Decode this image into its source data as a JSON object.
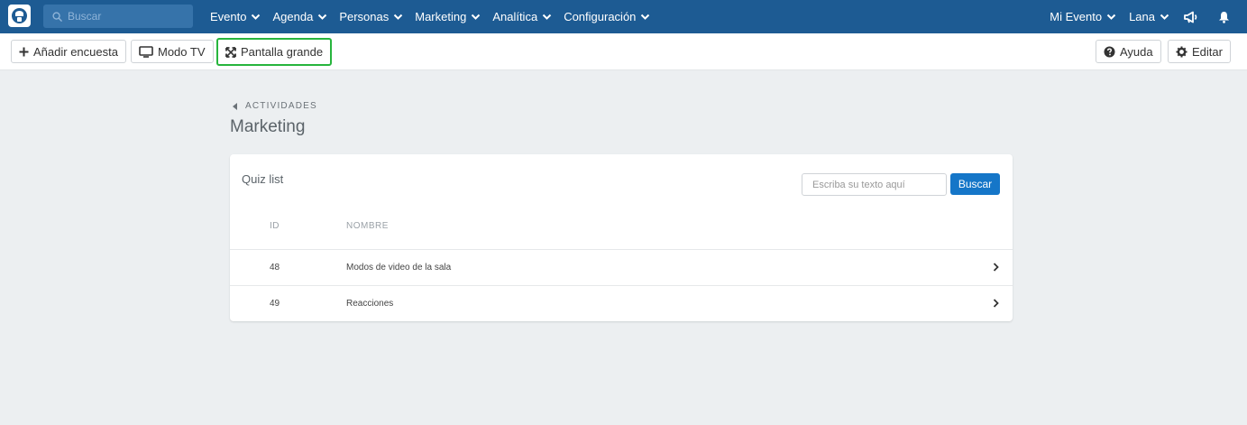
{
  "topbar": {
    "search_placeholder": "Buscar",
    "nav": [
      {
        "label": "Evento"
      },
      {
        "label": "Agenda"
      },
      {
        "label": "Personas"
      },
      {
        "label": "Marketing"
      },
      {
        "label": "Analítica"
      },
      {
        "label": "Configuración"
      }
    ],
    "right": {
      "event_label": "Mi Evento",
      "user_label": "Lana",
      "announce_icon": "megaphone-icon",
      "notify_icon": "bell-icon"
    },
    "colors": {
      "bar": "#1d5b93",
      "search_bg": "#3673aa"
    }
  },
  "toolbar": {
    "add_survey_label": "Añadir encuesta",
    "tv_mode_label": "Modo TV",
    "big_screen_label": "Pantalla grande",
    "help_label": "Ayuda",
    "edit_label": "Editar",
    "active_border_color": "#27b53d"
  },
  "page": {
    "breadcrumb": "ACTIVIDADES",
    "title": "Marketing"
  },
  "quiz": {
    "title": "Quiz list",
    "search_placeholder": "Escriba su texto aquí",
    "search_button": "Buscar",
    "columns": {
      "id": "ID",
      "name": "NOMBRE"
    },
    "rows": [
      {
        "id": "48",
        "name": "Modos de video de la sala"
      },
      {
        "id": "49",
        "name": "Reacciones"
      }
    ],
    "button_color": "#1576c8"
  }
}
